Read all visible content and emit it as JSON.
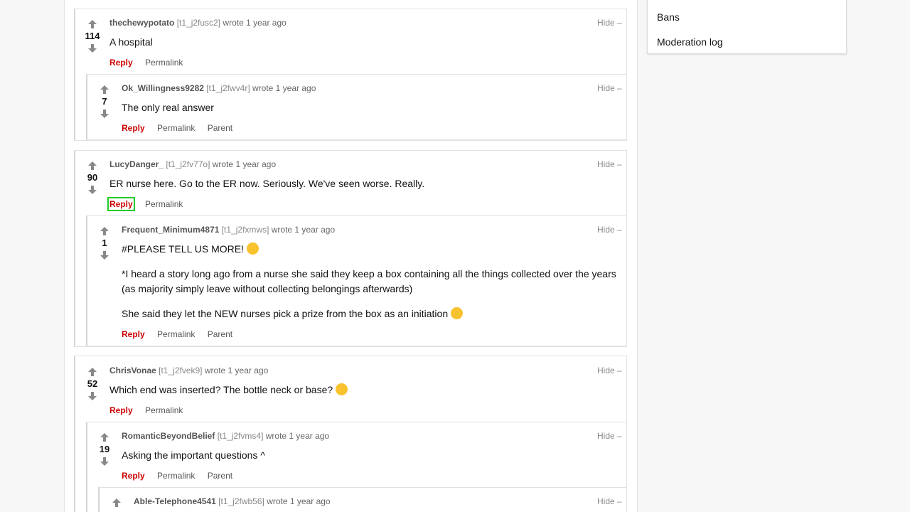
{
  "sidebar": {
    "bans": "Bans",
    "modlog": "Moderation log"
  },
  "comments": [
    {
      "author": "thechewypotato",
      "id": "[t1_j2fusc2]",
      "time": "wrote 1 year ago",
      "score": "114",
      "text": "A hospital",
      "hide": "Hide –",
      "reply": "Reply",
      "permalink": "Permalink"
    },
    {
      "author": "Ok_Willingness9282",
      "id": "[t1_j2fwv4r]",
      "time": "wrote 1 year ago",
      "score": "7",
      "text": "The only real answer",
      "hide": "Hide –",
      "reply": "Reply",
      "permalink": "Permalink",
      "parent": "Parent"
    },
    {
      "author": "LucyDanger_",
      "id": "[t1_j2fv77o]",
      "time": "wrote 1 year ago",
      "score": "90",
      "text": "ER nurse here. Go to the ER now. Seriously. We've seen worse. Really.",
      "hide": "Hide –",
      "reply": "Reply",
      "permalink": "Permalink"
    },
    {
      "author": "Frequent_Minimum4871",
      "id": "[t1_j2fxmws]",
      "time": "wrote 1 year ago",
      "score": "1",
      "text1": "#PLEASE TELL US MORE!",
      "text2": "*I heard a story long ago from a nurse she said they keep a box containing all the things collected over the years (as majority simply leave without collecting belongings afterwards)",
      "text3": "She said they let the NEW nurses pick a prize from the box as an initiation",
      "hide": "Hide –",
      "reply": "Reply",
      "permalink": "Permalink",
      "parent": "Parent"
    },
    {
      "author": "ChrisVonae",
      "id": "[t1_j2fvek9]",
      "time": "wrote 1 year ago",
      "score": "52",
      "text": "Which end was inserted? The bottle neck or base?",
      "hide": "Hide –",
      "reply": "Reply",
      "permalink": "Permalink"
    },
    {
      "author": "RomanticBeyondBelief",
      "id": "[t1_j2fvms4]",
      "time": "wrote 1 year ago",
      "score": "19",
      "text": "Asking the important questions ^",
      "hide": "Hide –",
      "reply": "Reply",
      "permalink": "Permalink",
      "parent": "Parent"
    },
    {
      "author": "Able-Telephone4541",
      "id": "[t1_j2fwb56]",
      "time": "wrote 1 year ago",
      "hide": "Hide –"
    }
  ],
  "colors": {
    "reply": "#cc0000",
    "focus": "#22cc22",
    "arrow": "#888888"
  }
}
